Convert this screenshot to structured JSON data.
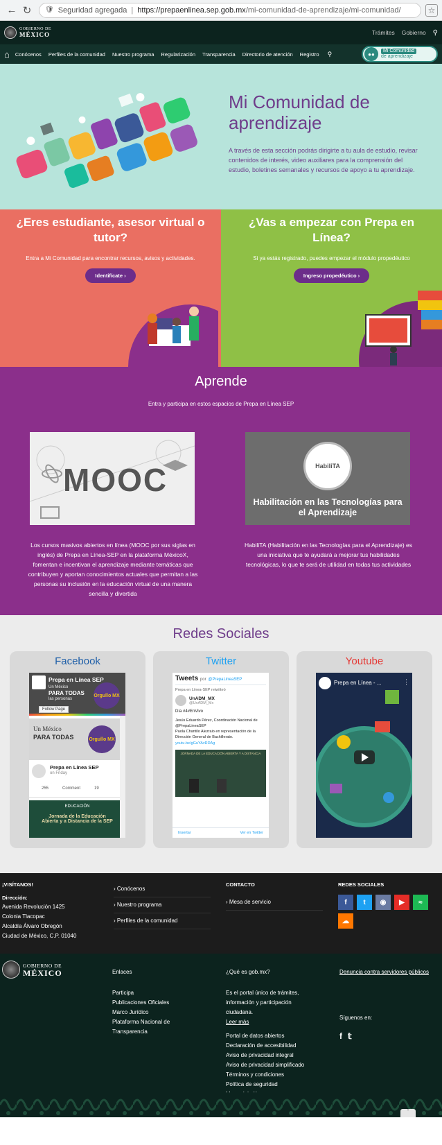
{
  "browser": {
    "secure_label": "Seguridad agregada",
    "url_host": "https://prepaenlinea.sep.gob.mx",
    "url_path": "/mi-comunidad-de-aprendizaje/mi-comunidad/"
  },
  "header": {
    "logo_line1": "GOBIERNO DE",
    "logo_line2": "MÉXICO",
    "links": [
      "Trámites",
      "Gobierno"
    ]
  },
  "nav": {
    "items": [
      "Conócenos",
      "Perfiles de la comunidad",
      "Nuestro programa",
      "Regularización",
      "Transparencia",
      "Directorio de atención",
      "Registro"
    ],
    "mc_button_line1": "Mi Comunidad",
    "mc_button_line2": "de aprendizaje"
  },
  "hero": {
    "title": "Mi Comunidad de aprendizaje",
    "description": "A través de esta sección podrás dirigirte a tu aula de estudio, revisar contenidos de interés, video auxiliares para la comprensión del estudio, boletines semanales y recursos de apoyo a tu aprendizaje."
  },
  "left_panel": {
    "title": "¿Eres estudiante, asesor virtual o tutor?",
    "text": "Entra a Mi Comunidad para encontrar recursos, avisos y actividades.",
    "button": "Identifícate"
  },
  "right_panel": {
    "title": "¿Vas a empezar con Prepa en Línea?",
    "text": "Si ya estás registrado, puedes empezar el módulo propedéutico",
    "button": "Ingreso propedéutico"
  },
  "aprende": {
    "title": "Aprende",
    "subtitle": "Entra y participa en estos espacios de Prepa en Línea SEP",
    "mooc_image_text": "MOOC",
    "mooc_text": "Los cursos masivos abiertos en línea (MOOC por sus siglas en inglés) de Prepa en Línea-SEP en la plataforma MéxicoX, fomentan e incentivan el aprendizaje mediante temáticas que contribuyen y aportan conocimientos actuales que permitan a las personas su inclusión en la educación virtual de una manera sencilla y divertida",
    "habilita_badge": "HabiliTA",
    "habilita_image_text": "Habilitación en las Tecnologías para el Aprendizaje",
    "habilita_text": "HabiliTA (Habilitación en las Tecnologías para el Aprendizaje) es una iniciativa que te ayudará a mejorar tus habilidades tecnológicas, lo que te será de utilidad en todas tus actividades"
  },
  "redes": {
    "title": "Redes Sociales",
    "facebook": {
      "label": "Facebook",
      "page_name": "Prepa en Línea SEP",
      "follow": "Follow Page",
      "banner_line1": "Un México",
      "banner_line2": "PARA TODAS",
      "banner_line3": "las personas",
      "banner_badge": "Orgullo MX",
      "post_name": "Prepa en Línea SEP",
      "post_time": "on Friday",
      "post_likes": "255",
      "post_comment": "Comment",
      "post_shares": "19",
      "card_line1": "EDUCACIÓN",
      "card_line2": "Jornada de la Educación",
      "card_line3": "Abierta y a Distancia de la SEP"
    },
    "twitter": {
      "label": "Twitter",
      "header": "Tweets",
      "header_by": "por",
      "header_handle": "@PrepaLineaSEP",
      "retweet": "Prepa en Línea-SEP retwitteó",
      "user": "UnADM_MX",
      "handle": "@UnADM_Mx",
      "line1": "Día #4#EnVivo",
      "line2": "Jesús Eduardo Pérez, Coordinación Nacional de @PrepaLineaSEP",
      "line3": "Paola Chantilo Alezraio en representación de la Dirección General de Bachillerato.",
      "link": "youtu.be/gGuYAvRDAg",
      "img_title": "JORNADA DE LA EDUCACIÓN ABIERTA Y A DISTANCIA",
      "footer_left": "Insertar",
      "footer_right": "Ver en Twitter"
    },
    "youtube": {
      "label": "Youtube",
      "video_title": "Prepa en Línea - ..."
    }
  },
  "footer_contact": {
    "visit_heading": "¡VISÍTANOS!",
    "address_label": "Dirección:",
    "address_lines": [
      "Avenida Revolución 1425",
      "Colonia Tlacopac",
      "Alcaldía Álvaro Obregón",
      "Ciudad de México, C.P. 01040"
    ],
    "links": [
      "Conócenos",
      "Nuestro programa",
      "Perfiles de la comunidad"
    ],
    "contact_heading": "CONTACTO",
    "contact_link": "Mesa de servicio",
    "social_heading": "REDES SOCIALES"
  },
  "footer_gob": {
    "logo_line1": "GOBIERNO DE",
    "logo_line2": "MÉXICO",
    "enlaces_heading": "Enlaces",
    "enlaces": [
      "Participa",
      "Publicaciones Oficiales",
      "Marco Jurídico",
      "Plataforma Nacional de Transparencia"
    ],
    "que_es_heading": "¿Qué es gob.mx?",
    "que_es_text": "Es el portal único de trámites, información y participación ciudadana.",
    "leer_mas": "Leer más",
    "more_links": [
      "Portal de datos abiertos",
      "Declaración de accesibilidad",
      "Aviso de privacidad integral",
      "Aviso de privacidad simplificado",
      "Términos y condiciones",
      "Política de seguridad",
      "Mapa del sitio"
    ],
    "denuncia": "Denuncia contra servidores públicos",
    "siguenos": "Síguenos en:"
  },
  "colors": {
    "gob_green": "#0c231e",
    "nav_green": "#13322b",
    "hero_bg": "#b7e4db",
    "purple": "#8b2f8b",
    "coral": "#ea6f62",
    "lime": "#8fc046"
  }
}
